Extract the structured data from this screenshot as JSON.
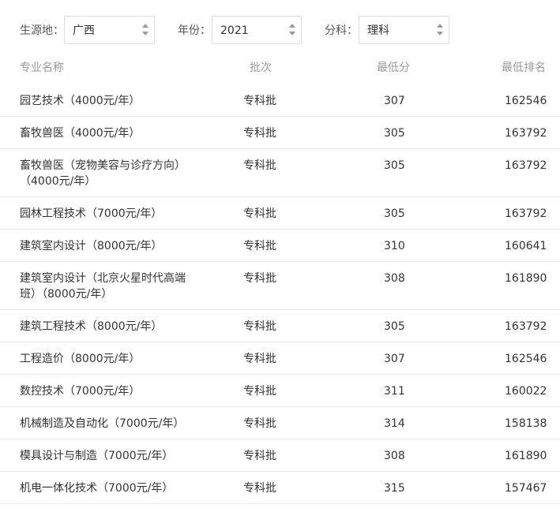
{
  "filters": {
    "origin_label": "生源地：",
    "origin_value": "广西",
    "year_label": "年份：",
    "year_value": "2021",
    "subject_label": "分科：",
    "subject_value": "理科"
  },
  "table": {
    "headers": {
      "name": "专业名称",
      "batch": "批次",
      "min_score": "最低分",
      "min_rank": "最低排名"
    },
    "rows": [
      {
        "name": "园艺技术（4000元/年）",
        "batch": "专科批",
        "min_score": "307",
        "min_rank": "162546"
      },
      {
        "name": "畜牧兽医（4000元/年）",
        "batch": "专科批",
        "min_score": "305",
        "min_rank": "163792"
      },
      {
        "name": "畜牧兽医（宠物美容与诊疗方向）（4000元/年）",
        "batch": "专科批",
        "min_score": "305",
        "min_rank": "163792"
      },
      {
        "name": "园林工程技术（7000元/年）",
        "batch": "专科批",
        "min_score": "305",
        "min_rank": "163792"
      },
      {
        "name": "建筑室内设计（8000元/年）",
        "batch": "专科批",
        "min_score": "310",
        "min_rank": "160641"
      },
      {
        "name": "建筑室内设计（北京火星时代高端班）（8000元/年）",
        "batch": "专科批",
        "min_score": "308",
        "min_rank": "161890"
      },
      {
        "name": "建筑工程技术（8000元/年）",
        "batch": "专科批",
        "min_score": "305",
        "min_rank": "163792"
      },
      {
        "name": "工程造价（8000元/年）",
        "batch": "专科批",
        "min_score": "307",
        "min_rank": "162546"
      },
      {
        "name": "数控技术（7000元/年）",
        "batch": "专科批",
        "min_score": "311",
        "min_rank": "160022"
      },
      {
        "name": "机械制造及自动化（7000元/年）",
        "batch": "专科批",
        "min_score": "314",
        "min_rank": "158138"
      },
      {
        "name": "模具设计与制造（7000元/年）",
        "batch": "专科批",
        "min_score": "308",
        "min_rank": "161890"
      },
      {
        "name": "机电一体化技术（7000元/年）",
        "batch": "专科批",
        "min_score": "315",
        "min_rank": "157467"
      }
    ]
  }
}
